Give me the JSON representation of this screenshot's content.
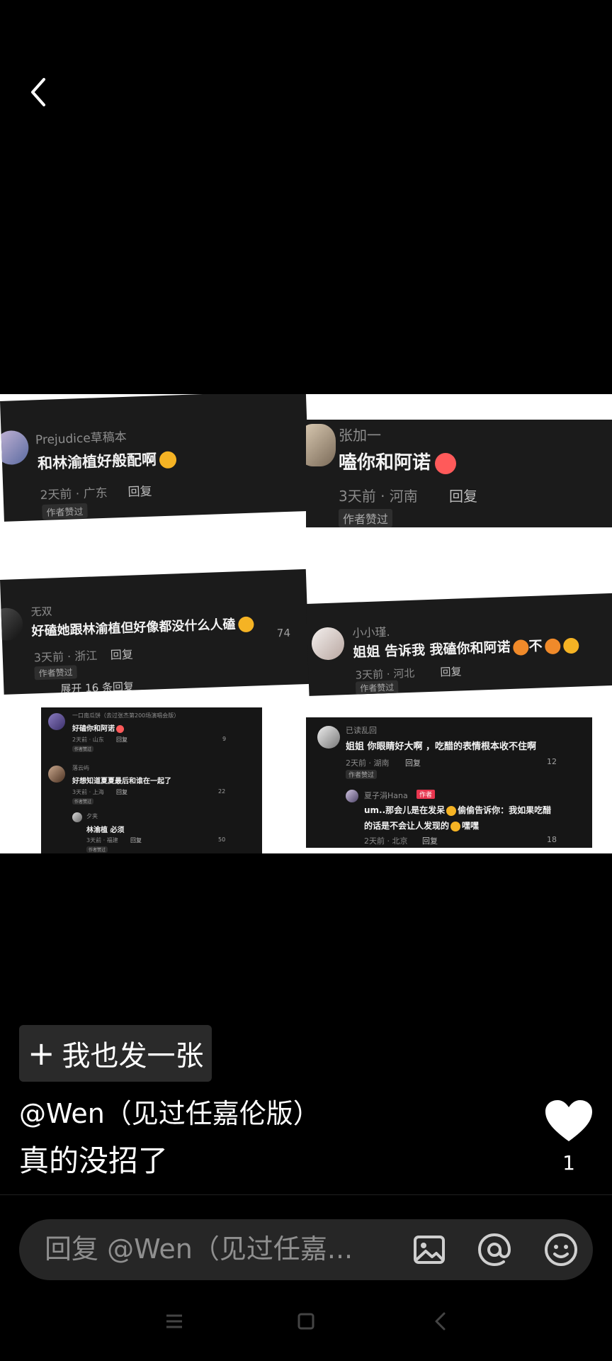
{
  "icons": {
    "back": "chevron-left-icon",
    "plus": "plus-icon",
    "like": "heart-icon",
    "image": "image-icon",
    "mention": "at-icon",
    "emoji": "emoji-icon"
  },
  "collage": {
    "c1": {
      "user": "Prejudice草稿本",
      "text": "和林渝植好般配啊",
      "meta": "2天前 · 广东",
      "reply": "回复",
      "badge": "作者赞过"
    },
    "c2": {
      "user": "张加一",
      "text": "嗑你和阿诺",
      "meta": "3天前 · 河南",
      "reply": "回复",
      "badge": "作者赞过"
    },
    "c3": {
      "user": "无双",
      "text": "好磕她跟林渝植但好像都没什么人磕",
      "meta": "3天前 · 浙江",
      "reply": "回复",
      "badge": "作者赞过",
      "likes": "74",
      "expand": "展开 16 条回复"
    },
    "c4": {
      "user": "小小瑾.",
      "text_a": "姐姐 告诉我 我磕你和阿诺",
      "text_b": "不",
      "meta": "3天前 · 河北",
      "reply": "回复",
      "badge": "作者赞过"
    },
    "c5": {
      "rows": [
        {
          "user": "一口南瓜饼（去过张杰第200场演唱会版）",
          "text": "好磕你和阿诺",
          "meta": "2天前 · 山东",
          "reply": "回复",
          "badge": "作者赞过",
          "likes": "9"
        },
        {
          "user": "落云屿",
          "text": "好想知道夏夏最后和谁在一起了",
          "meta": "3天前 · 上海",
          "reply": "回复",
          "badge": "作者赞过",
          "likes": "22"
        },
        {
          "user": "夕夹",
          "text": "林渝植 必须",
          "meta": "3天前 · 福建",
          "reply": "回复",
          "badge": "作者赞过",
          "likes": "50"
        }
      ]
    },
    "c6": {
      "user1": "已读乱回",
      "text1": "姐姐 你眼睛好大啊 ，吃醋的表情根本收不住啊",
      "meta1": "2天前 · 湖南",
      "reply1": "回复",
      "badge1": "作者赞过",
      "likes1": "12",
      "user2": "夏子涓Hana",
      "author_tag": "作者",
      "text2a": "um..那会儿是在发呆",
      "text2b": "偷偷告诉你：我如果吃醋",
      "text2c": "的话是不会让人发现的",
      "text2d": "嘿嘿",
      "meta2": "2天前 · 北京",
      "reply2": "回复",
      "likes2": "18"
    }
  },
  "post": {
    "button_label": "我也发一张",
    "author": "@Wen（见过任嘉伦版）",
    "caption": "真的没招了",
    "like_count": "1"
  },
  "reply_bar": {
    "placeholder": "回复 @Wen（见过任嘉..."
  }
}
